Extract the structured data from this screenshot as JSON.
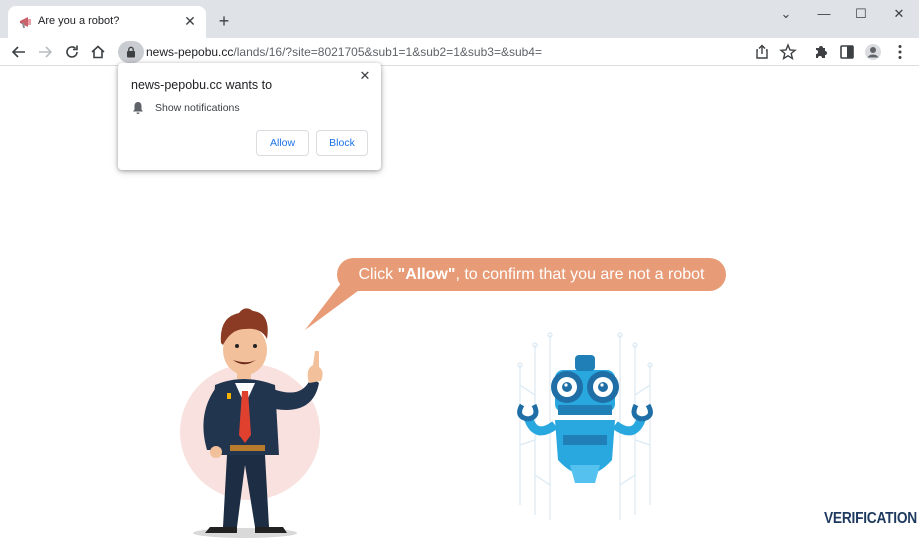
{
  "browser": {
    "tab": {
      "title": "Are you a robot?",
      "close_glyph": "✕",
      "favicon_icon": "megaphone-icon"
    },
    "new_tab_glyph": "+",
    "window_controls": {
      "dropdown": "⌄",
      "minimize": "—",
      "maximize": "☐",
      "close": "✕"
    },
    "toolbar": {
      "back_icon": "back-arrow-icon",
      "forward_icon": "forward-arrow-icon",
      "reload_icon": "reload-icon",
      "home_icon": "home-icon",
      "url_domain": "news-pepobu.cc",
      "url_rest": "/lands/16/?site=8021705&sub1=1&sub2=1&sub3=&sub4="
    }
  },
  "popup": {
    "title": "news-pepobu.cc wants to",
    "permission": "Show notifications",
    "close_glyph": "✕",
    "allow_label": "Allow",
    "block_label": "Block"
  },
  "page": {
    "bubble_prefix": "Click ",
    "bubble_bold": "\"Allow\"",
    "bubble_suffix": ", to confirm that you are not a robot",
    "watermark": "VERIFICATION",
    "colors": {
      "bubble": "#e79b76",
      "robot": "#29a8e0",
      "accent_blue": "#1a73e8"
    }
  }
}
